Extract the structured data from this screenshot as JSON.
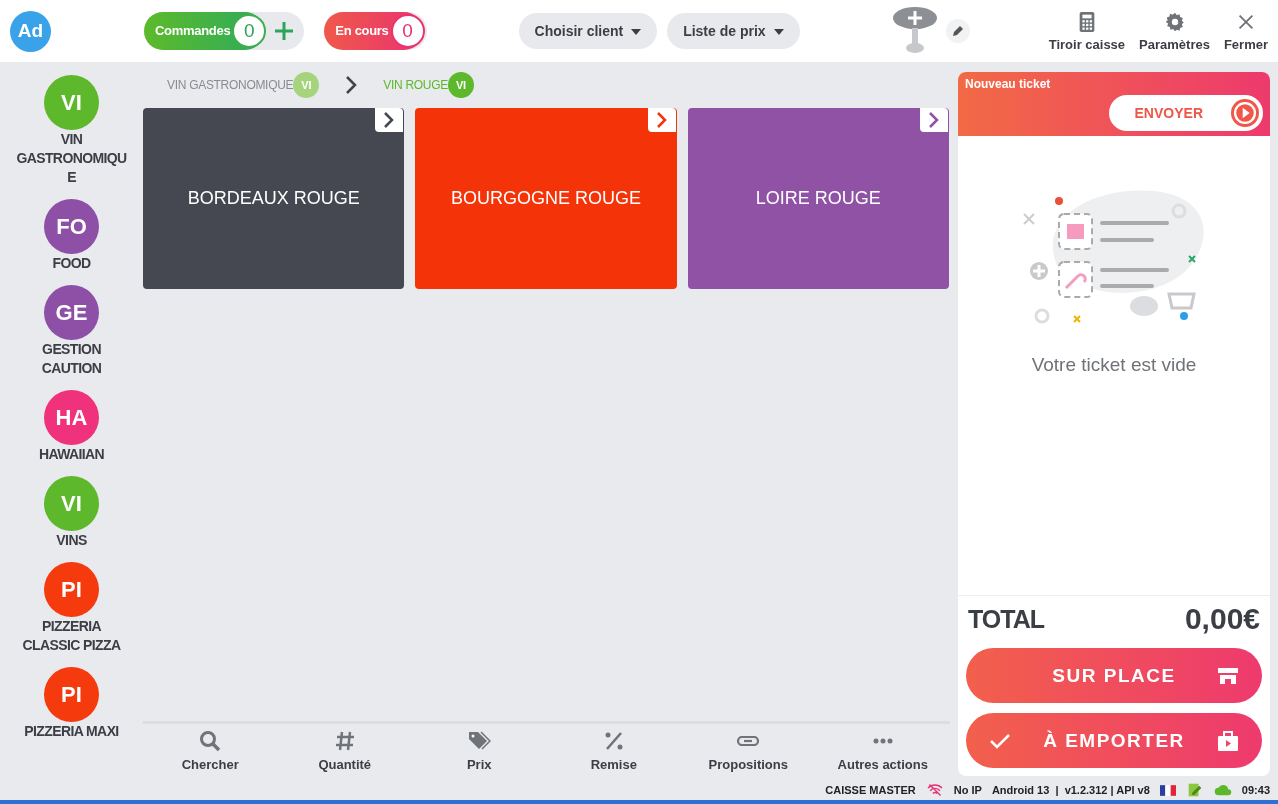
{
  "top_bar": {
    "avatar": "Ad",
    "orders": {
      "label": "Commandes",
      "count": "0"
    },
    "in_progress": {
      "label": "En cours",
      "count": "0"
    },
    "dropdowns": [
      {
        "label": "Choisir client"
      },
      {
        "label": "Liste de prix"
      }
    ],
    "actions": [
      {
        "kind": "calculator",
        "label": "Tiroir caisse"
      },
      {
        "kind": "gear",
        "label": "Paramètres"
      },
      {
        "kind": "close",
        "label": "Fermer"
      }
    ]
  },
  "categories": [
    {
      "badge": "VI",
      "label": "VIN GASTRONOMIQUE",
      "color": "#5db82b"
    },
    {
      "badge": "FO",
      "label": "FOOD",
      "color": "#8e50a6"
    },
    {
      "badge": "GE",
      "label": "GESTION CAUTION",
      "color": "#8e50a6"
    },
    {
      "badge": "HA",
      "label": "HAWAIIAN",
      "color": "#f0317b"
    },
    {
      "badge": "VI",
      "label": "VINS",
      "color": "#5db82b"
    },
    {
      "badge": "PI",
      "label": "PIZZERIA CLASSIC PIZZA",
      "color": "#f53a0e"
    },
    {
      "badge": "PI",
      "label": "PIZZERIA MAXI",
      "color": "#f53a0e"
    }
  ],
  "breadcrumb": [
    {
      "label": "VIN GASTRONOMIQUE",
      "badge": "VI",
      "selected": false
    },
    {
      "label": "VIN ROUGE",
      "badge": "VI",
      "selected": true
    }
  ],
  "tiles": [
    {
      "label": "BORDEAUX ROUGE",
      "color": "#454851"
    },
    {
      "label": "BOURGOGNE ROUGE",
      "color": "#f43408"
    },
    {
      "label": "LOIRE ROUGE",
      "color": "#8f52a5"
    }
  ],
  "toolbar": [
    {
      "kind": "search",
      "label": "Chercher"
    },
    {
      "kind": "hash",
      "label": "Quantité"
    },
    {
      "kind": "tag",
      "label": "Prix"
    },
    {
      "kind": "percent",
      "label": "Remise"
    },
    {
      "kind": "link",
      "label": "Propositions"
    },
    {
      "kind": "dots",
      "label": "Autres actions"
    }
  ],
  "ticket": {
    "title": "Nouveau ticket",
    "send": "ENVOYER",
    "empty": "Votre ticket est vide",
    "total_label": "TOTAL",
    "total": "0,00€",
    "modes": [
      {
        "kind": "store",
        "label": "SUR PLACE",
        "selected": false
      },
      {
        "kind": "bag",
        "label": "À EMPORTER",
        "selected": true
      }
    ]
  },
  "status_bar": {
    "device": "CAISSE MASTER",
    "network": "No IP",
    "system": "Android 13  |  v1.2.312 | API v8",
    "time": "09:43"
  }
}
